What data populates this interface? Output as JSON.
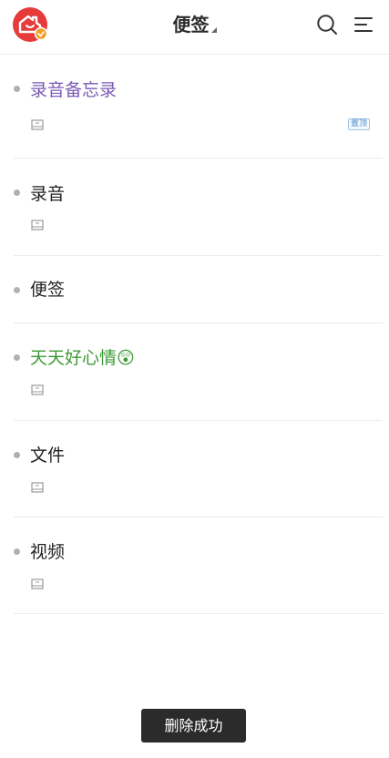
{
  "header": {
    "title": "便签",
    "avatar_icon": "house-heart-icon",
    "search_icon": "search-icon",
    "menu_icon": "menu-icon"
  },
  "notes": [
    {
      "name": "录音备忘录",
      "color": "#7a5bb4",
      "has_attachment_icon": true,
      "pinned": true,
      "pin_label": "置顶"
    },
    {
      "name": "录音",
      "color": "#222222",
      "has_attachment_icon": true,
      "pinned": false
    },
    {
      "name": "便签",
      "color": "#222222",
      "has_attachment_icon": false,
      "pinned": false
    },
    {
      "name": "天天好心情😲",
      "color": "#3d9a36",
      "has_attachment_icon": true,
      "pinned": false
    },
    {
      "name": "文件",
      "color": "#222222",
      "has_attachment_icon": true,
      "pinned": false
    },
    {
      "name": "视频",
      "color": "#222222",
      "has_attachment_icon": true,
      "pinned": false
    }
  ],
  "toast": {
    "message": "删除成功"
  },
  "colors": {
    "brand_red": "#e53b3b",
    "badge_orange": "#f0a02a",
    "divider": "#ececec"
  }
}
